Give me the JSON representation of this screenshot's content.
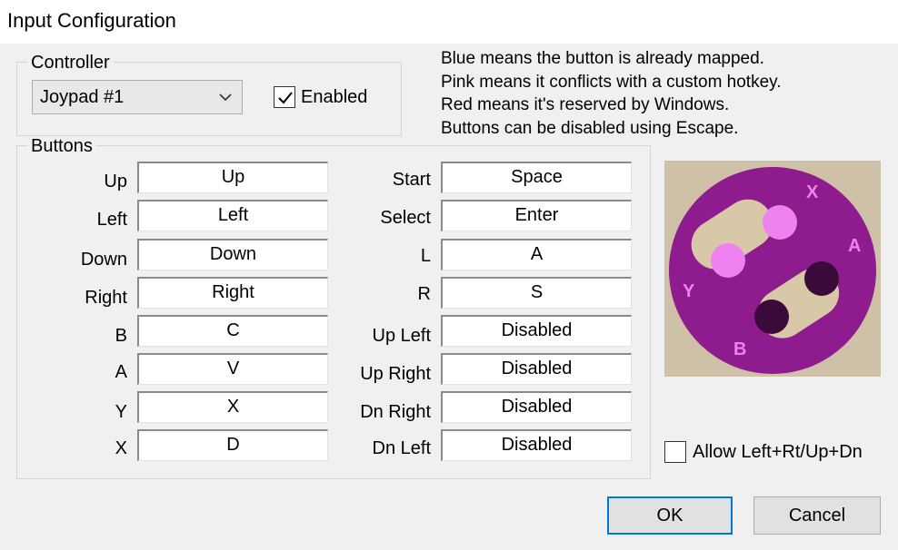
{
  "window": {
    "title": "Input Configuration"
  },
  "controller": {
    "group_label": "Controller",
    "selected": "Joypad #1",
    "enabled_label": "Enabled",
    "enabled": true
  },
  "info_lines": [
    "Blue means the button is already mapped.",
    "Pink means it conflicts with a custom hotkey.",
    "Red means it's reserved by Windows.",
    "Buttons can be disabled using Escape."
  ],
  "buttons": {
    "group_label": "Buttons",
    "left": [
      {
        "label": "Up",
        "value": "Up"
      },
      {
        "label": "Left",
        "value": "Left"
      },
      {
        "label": "Down",
        "value": "Down"
      },
      {
        "label": "Right",
        "value": "Right"
      },
      {
        "label": "B",
        "value": "C"
      },
      {
        "label": "A",
        "value": "V"
      },
      {
        "label": "Y",
        "value": "X"
      },
      {
        "label": "X",
        "value": "D"
      }
    ],
    "right": [
      {
        "label": "Start",
        "value": "Space"
      },
      {
        "label": "Select",
        "value": "Enter"
      },
      {
        "label": "L",
        "value": "A"
      },
      {
        "label": "R",
        "value": "S"
      },
      {
        "label": "Up Left",
        "value": "Disabled"
      },
      {
        "label": "Up Right",
        "value": "Disabled"
      },
      {
        "label": "Dn Right",
        "value": "Disabled"
      },
      {
        "label": "Dn Left",
        "value": "Disabled"
      }
    ]
  },
  "pad_diagram": {
    "labels": {
      "x": "X",
      "a": "A",
      "y": "Y",
      "b": "B"
    },
    "colors": {
      "face": "#8e1c8e",
      "pink": "#ee82ee",
      "dark": "#3a0a3a",
      "tan": "#cfc0a8"
    }
  },
  "allow_option": {
    "label": "Allow Left+Rt/Up+Dn",
    "checked": false
  },
  "dialog_buttons": {
    "ok": "OK",
    "cancel": "Cancel"
  },
  "colors": {
    "accent": "#0078d7"
  }
}
